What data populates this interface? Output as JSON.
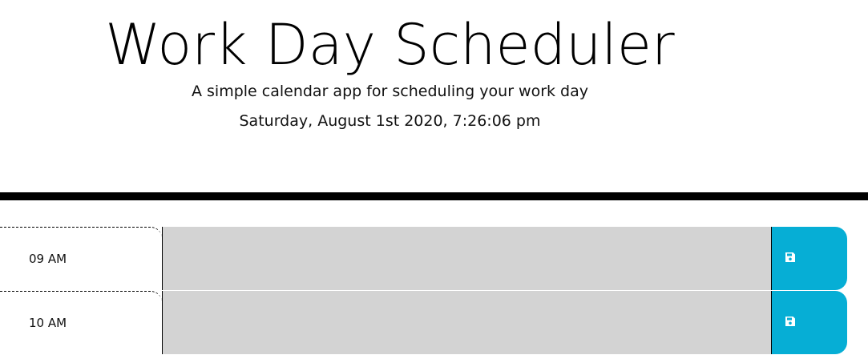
{
  "header": {
    "title": "Work Day Scheduler",
    "lead": "A simple calendar app for scheduling your work day",
    "current_day": "Saturday, August 1st 2020, 7:26:06 pm"
  },
  "colors": {
    "save_button": "#06aed5",
    "textarea_past": "#d3d3d3",
    "divider": "#000000"
  },
  "timeblocks": [
    {
      "hour": "09 AM",
      "description": "",
      "save_icon": "save-icon"
    },
    {
      "hour": "10 AM",
      "description": "",
      "save_icon": "save-icon"
    }
  ]
}
